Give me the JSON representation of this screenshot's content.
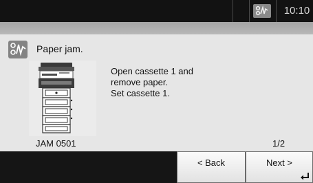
{
  "status_bar": {
    "time": "10:10",
    "warning_icon": "paper-jam-icon"
  },
  "alert": {
    "icon": "paper-jam-icon",
    "title": "Paper jam.",
    "message_lines": [
      "Open cassette 1 and",
      "remove paper.",
      "Set cassette 1."
    ],
    "jam_code": "JAM 0501",
    "page_indicator": "1/2"
  },
  "buttons": {
    "back_label": "< Back",
    "next_label": "Next >",
    "next_icon": "enter-icon"
  },
  "colors": {
    "status_bar": "#121212",
    "panel": "#e6e6e6",
    "icon_bg": "#838383"
  }
}
